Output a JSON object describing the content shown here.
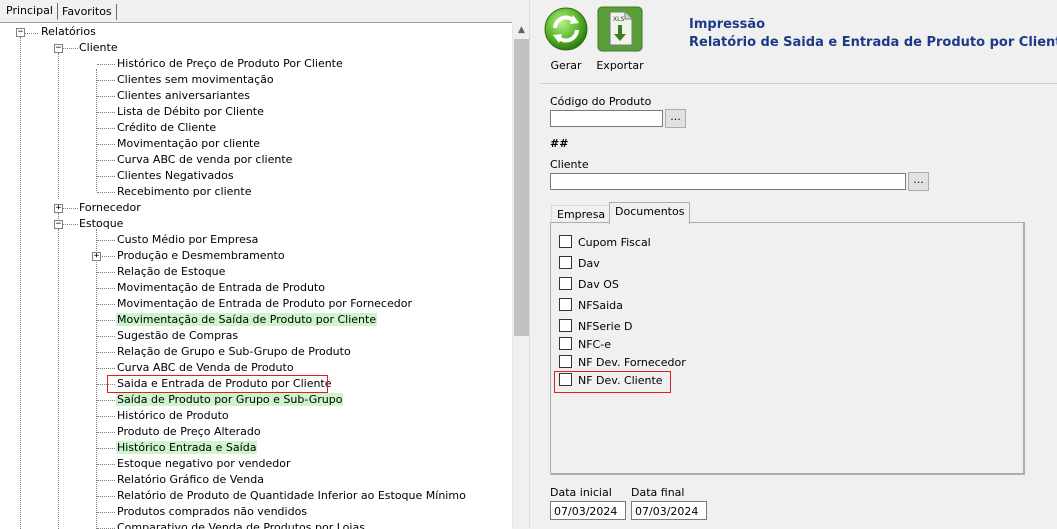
{
  "tabs": [
    {
      "label": "Principal"
    },
    {
      "label": "Favoritos"
    }
  ],
  "tree": {
    "root": "Relatórios",
    "cliente": {
      "label": "Cliente",
      "items": [
        "Histórico de Preço de Produto Por Cliente",
        "Clientes sem movimentação",
        "Clientes aniversariantes",
        "Lista de Débito por Cliente",
        "Crédito de Cliente",
        "Movimentação por cliente",
        "Curva ABC de venda por cliente",
        "Clientes Negativados",
        "Recebimento por cliente"
      ]
    },
    "fornecedor": {
      "label": "Fornecedor"
    },
    "estoque": {
      "label": "Estoque",
      "items": [
        "Custo Médio por Empresa",
        "Produção e Desmembramento",
        "Relação de Estoque",
        "Movimentação de Entrada de Produto",
        "Movimentação de Entrada de Produto por Fornecedor",
        "Movimentação de Saída de Produto por Cliente",
        "Sugestão de Compras",
        "Relação de Grupo e Sub-Grupo de Produto",
        "Curva ABC de Venda de Produto",
        "Saida e Entrada de Produto por Cliente",
        "Saída de Produto por Grupo e Sub-Grupo",
        "Histórico de Produto",
        "Produto de Preço Alterado",
        "Histórico Entrada e Saída",
        "Estoque negativo por vendedor",
        "Relatório Gráfico de Venda",
        "Relatório de Produto de Quantidade Inferior ao Estoque Mínimo",
        "Produtos comprados não vendidos",
        "Comparativo de Venda de Produtos por Lojas"
      ]
    }
  },
  "toolbar": {
    "gerar_label": "Gerar",
    "exportar_label": "Exportar"
  },
  "header": {
    "title": "Impressão",
    "subtitle": "Relatório de Saida e Entrada de Produto por Cliente"
  },
  "form": {
    "codigo_label": "Código do Produto",
    "codigo_value": "",
    "browse_label": "...",
    "hash_text": "##",
    "cliente_label": "Cliente",
    "cliente_value": "",
    "tabs": [
      {
        "label": "Empresa"
      },
      {
        "label": "Documentos"
      }
    ],
    "documentos": [
      {
        "label": "Cupom Fiscal",
        "checked": false
      },
      {
        "label": "Dav",
        "checked": false
      },
      {
        "label": "Dav OS",
        "checked": false
      },
      {
        "label": "NFSaida",
        "checked": false
      },
      {
        "label": "NFSerie D",
        "checked": false
      },
      {
        "label": "NFC-e",
        "checked": false
      },
      {
        "label": "NF Dev. Fornecedor",
        "checked": false
      },
      {
        "label": "NF Dev. Cliente",
        "checked": false
      }
    ],
    "data_inicial_label": "Data inicial",
    "data_inicial_value": "07/03/2024",
    "data_final_label": "Data final",
    "data_final_value": "07/03/2024"
  },
  "colors": {
    "title": "#1c3a86",
    "highlight": "#ccf5cc",
    "selection_box": "#e02020"
  }
}
